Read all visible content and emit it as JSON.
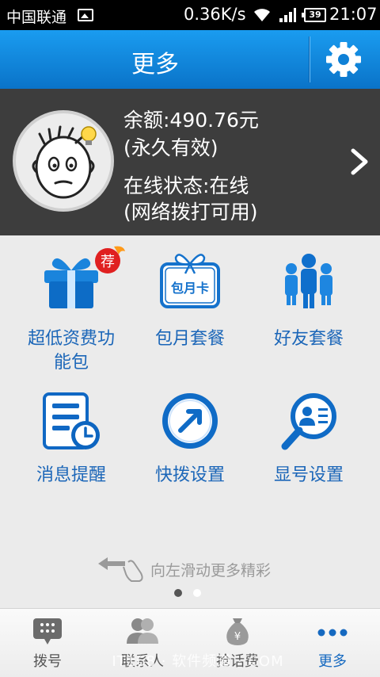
{
  "status_bar": {
    "carrier": "中国联通",
    "speed": "0.36K/s",
    "battery": "39",
    "time": "21:07"
  },
  "header": {
    "title": "更多",
    "settings_icon": "gear-icon"
  },
  "account": {
    "balance": "余额:490.76元",
    "validity": "(永久有效)",
    "online_status": "在线状态:在线",
    "call_status": "(网络拨打可用)"
  },
  "tiles": [
    {
      "label_line1": "超低资费功",
      "label_line2": "能包",
      "icon": "gift-icon",
      "badge": "荐"
    },
    {
      "label_line1": "包月套餐",
      "label_line2": "",
      "icon": "monthly-card-icon",
      "card_text": "包月卡"
    },
    {
      "label_line1": "好友套餐",
      "label_line2": "",
      "icon": "friends-icon"
    },
    {
      "label_line1": "消息提醒",
      "label_line2": "",
      "icon": "message-reminder-icon"
    },
    {
      "label_line1": "快拨设置",
      "label_line2": "",
      "icon": "speed-dial-icon"
    },
    {
      "label_line1": "显号设置",
      "label_line2": "",
      "icon": "caller-id-icon"
    }
  ],
  "swipe_hint": "向左滑动更多精彩",
  "pager": {
    "total": 2,
    "current": 1
  },
  "bottom_nav": [
    {
      "label": "拨号",
      "icon": "dialpad-icon",
      "active": false
    },
    {
      "label": "联系人",
      "icon": "contacts-icon",
      "active": false
    },
    {
      "label": "抢话费",
      "icon": "money-bag-icon",
      "active": false
    },
    {
      "label": "更多",
      "icon": "more-dots-icon",
      "active": true
    }
  ],
  "watermark": "IT168 · 软件频道 · COM",
  "colors": {
    "header_blue": "#0a73c8",
    "accent_blue": "#1b66b8",
    "panel_dark": "#3d3d3d",
    "badge_red": "#e02020"
  }
}
